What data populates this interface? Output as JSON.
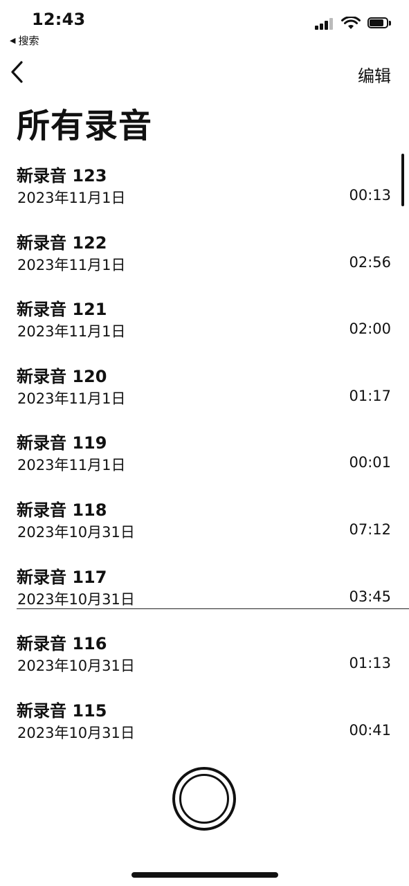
{
  "status_bar": {
    "time": "12:43",
    "back_label": "搜索",
    "back_arrow": "◀"
  },
  "nav": {
    "edit_label": "编辑"
  },
  "page": {
    "title": "所有录音"
  },
  "recordings": [
    {
      "title": "新录音 123",
      "date": "2023年11月1日",
      "duration": "00:13"
    },
    {
      "title": "新录音 122",
      "date": "2023年11月1日",
      "duration": "02:56"
    },
    {
      "title": "新录音 121",
      "date": "2023年11月1日",
      "duration": "02:00"
    },
    {
      "title": "新录音 120",
      "date": "2023年11月1日",
      "duration": "01:17"
    },
    {
      "title": "新录音 119",
      "date": "2023年11月1日",
      "duration": "00:01"
    },
    {
      "title": "新录音 118",
      "date": "2023年10月31日",
      "duration": "07:12"
    },
    {
      "title": "新录音 117",
      "date": "2023年10月31日",
      "duration": "03:45"
    },
    {
      "title": "新录音 116",
      "date": "2023年10月31日",
      "duration": "01:13"
    },
    {
      "title": "新录音 115",
      "date": "2023年10月31日",
      "duration": "00:41"
    }
  ],
  "icons": {
    "signal": "cellular-signal-icon",
    "wifi": "wifi-icon",
    "battery": "battery-icon",
    "back": "chevron-left-icon",
    "record": "record-button"
  },
  "colors": {
    "text": "#111111",
    "background": "#ffffff"
  }
}
